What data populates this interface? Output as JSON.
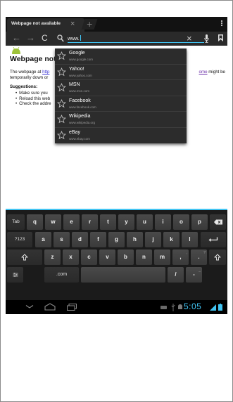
{
  "tab": {
    "title": "Webpage not available",
    "close": "×",
    "new_tab": "+"
  },
  "urlbar": {
    "back": "←",
    "forward": "→",
    "reload": "C",
    "value": "www.",
    "clear": "×"
  },
  "page": {
    "title": "Webpage not a",
    "para_lead": "The webpage at ",
    "para_link": "http",
    "para_line2": "temporarily down or",
    "right_link": "ome",
    "right_text": " might be",
    "suggestions_heading": "Suggestions:",
    "bullets": [
      "Make sure you",
      "Reload this web",
      "Check the addre"
    ]
  },
  "suggestions": [
    {
      "name": "Google",
      "url": "www.google.com"
    },
    {
      "name": "Yahoo!",
      "url": "www.yahoo.com"
    },
    {
      "name": "MSN",
      "url": "www.msn.com"
    },
    {
      "name": "Facebook",
      "url": "www.facebook.com"
    },
    {
      "name": "Wikipedia",
      "url": "www.wikipedia.org"
    },
    {
      "name": "eBay",
      "url": "www.ebay.com"
    }
  ],
  "keyboard": {
    "row1": [
      "Tab",
      "q",
      "w",
      "e",
      "r",
      "t",
      "y",
      "u",
      "i",
      "o",
      "p"
    ],
    "row2": [
      "?123",
      "a",
      "s",
      "d",
      "f",
      "g",
      "h",
      "j",
      "k",
      "l"
    ],
    "row3": [
      "z",
      "x",
      "c",
      "v",
      "b",
      "n",
      "m",
      ",",
      "."
    ],
    "row3_sub": [
      ",",
      "?"
    ],
    "row4": {
      "domain": ".com",
      "slash": "/",
      "dash": "-",
      "dash_sub": "_"
    }
  },
  "status": {
    "time": "5:05"
  },
  "colors": {
    "accent": "#41c4f2",
    "link": "#3b35d4",
    "visited_link": "#6b2da8"
  }
}
